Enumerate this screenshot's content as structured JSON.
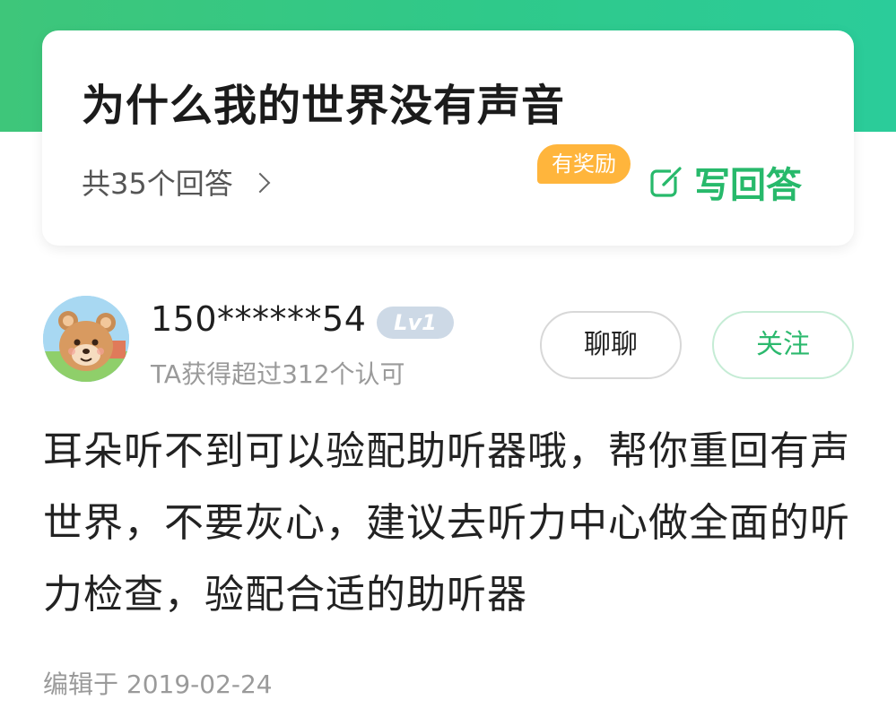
{
  "colors": {
    "brand_green": "#2fc98a",
    "accent_green": "#27b96b",
    "reward_orange": "#ffb53c",
    "level_badge": "#cdd9e6"
  },
  "question": {
    "title": "为什么我的世界没有声音",
    "answers_label": "共35个回答",
    "answers_icon": "chevron-right-icon",
    "reward_badge": "有奖励",
    "write_answer_label": "写回答",
    "write_answer_icon": "edit-icon"
  },
  "answer": {
    "user": {
      "name": "150******54",
      "level": "Lv1",
      "subtitle": "TA获得超过312个认可",
      "avatar_icon": "bear-avatar"
    },
    "chat_label": "聊聊",
    "follow_label": "关注",
    "content": "耳朵听不到可以验配助听器哦，帮你重回有声世界，不要灰心，建议去听力中心做全面的听力检查，验配合适的助听器",
    "edited": "编辑于 2019-02-24"
  }
}
